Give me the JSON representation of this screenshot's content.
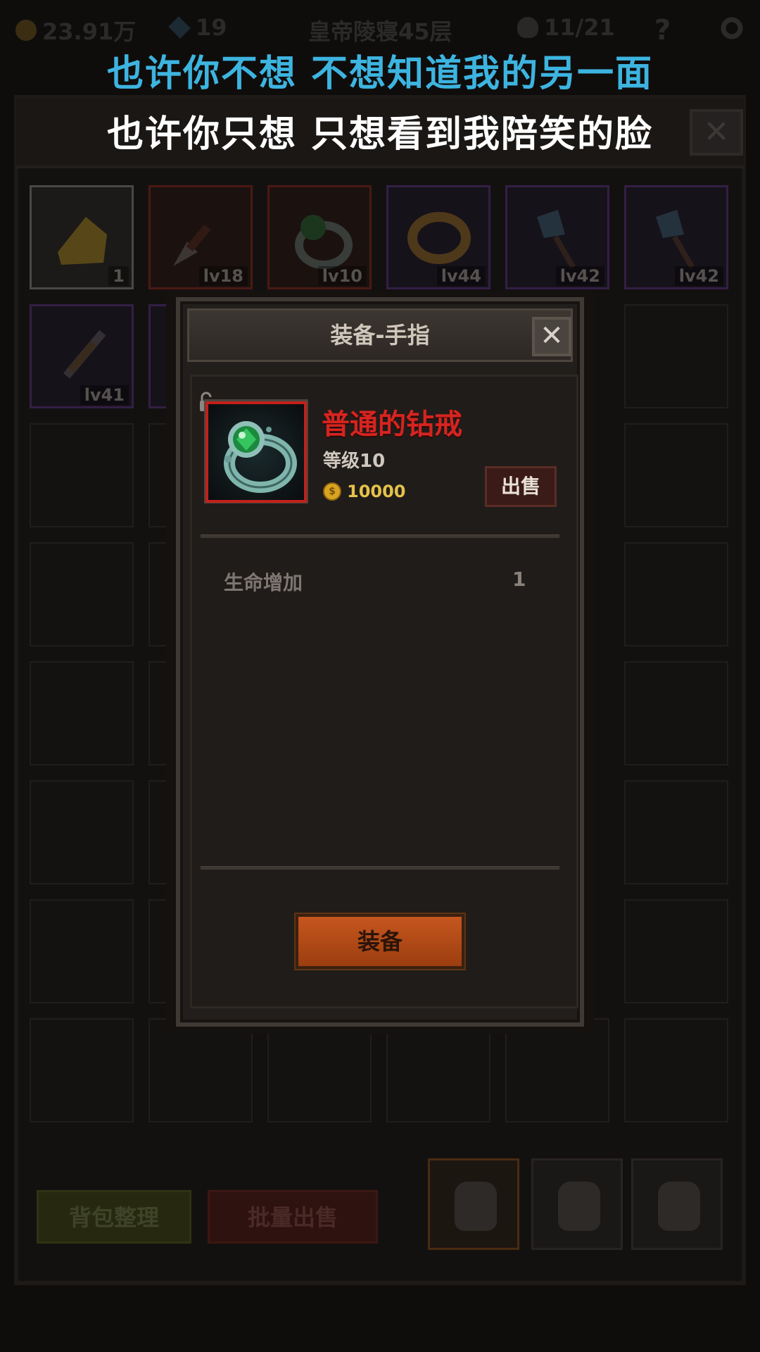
{
  "lyrics": {
    "line1": "也许你不想 不想知道我的另一面",
    "line2": "也许你只想 只想看到我陪笑的脸"
  },
  "topbar": {
    "gold": "23.91万",
    "gems": "19",
    "location": "皇帝陵寝45层",
    "kills": "11/21",
    "help": "?"
  },
  "inventory": {
    "row1": [
      {
        "level": "1",
        "rarity": "gray",
        "icon": "cheese-icon"
      },
      {
        "level": "lv18",
        "rarity": "red",
        "icon": "dagger-icon"
      },
      {
        "level": "lv10",
        "rarity": "red",
        "icon": "ring-icon"
      },
      {
        "level": "lv44",
        "rarity": "purple",
        "icon": "gold-ring-icon"
      },
      {
        "level": "lv42",
        "rarity": "purple",
        "icon": "crystal-staff-icon"
      },
      {
        "level": "lv42",
        "rarity": "purple",
        "icon": "crystal-staff-icon"
      }
    ],
    "row2_first": {
      "level": "lv41",
      "rarity": "purple",
      "icon": "sword-icon"
    },
    "sort_button": "背包整理",
    "bulk_sell_button": "批量出售"
  },
  "dialog": {
    "title": "装备-手指",
    "close": "✕",
    "item": {
      "name": "普通的钻戒",
      "level": "等级10",
      "price": "10000",
      "locked": true,
      "border_color": "#c3201a"
    },
    "sell_button": "出售",
    "stats": [
      {
        "name": "生命增加",
        "value": "1"
      }
    ],
    "equip_button": "装备"
  },
  "colors": {
    "lyric_line1": "#3db4e0",
    "lyric_line2": "#ffffff",
    "item_name": "#d62420",
    "price": "#e4c24a",
    "equip_button": "#c5561e"
  }
}
